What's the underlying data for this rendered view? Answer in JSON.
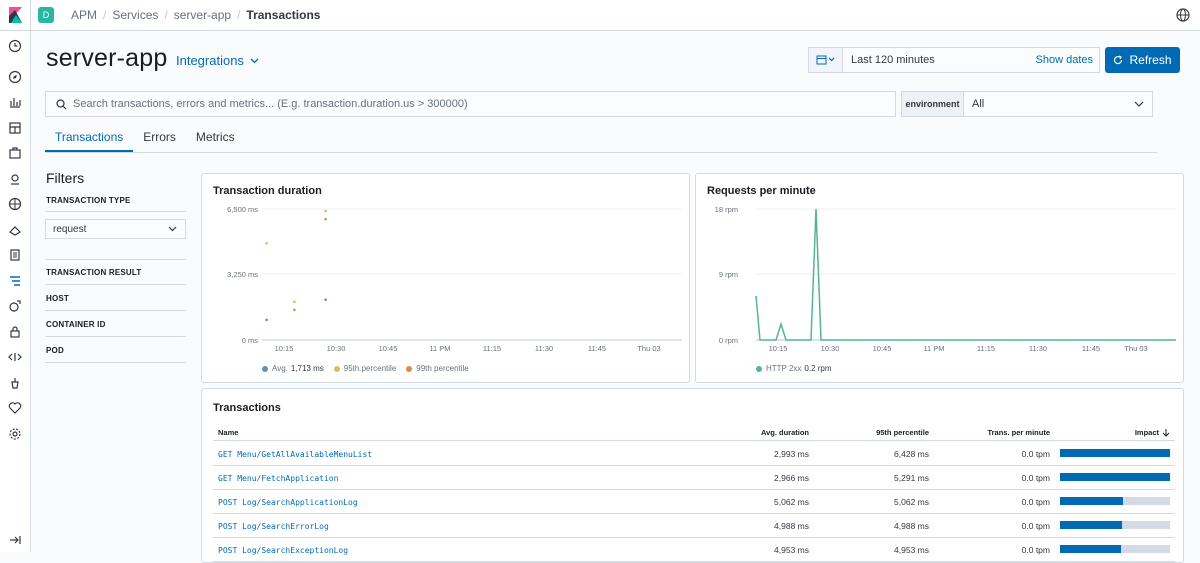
{
  "topbar": {
    "space_letter": "D",
    "breadcrumbs": [
      "APM",
      "Services",
      "server-app",
      "Transactions"
    ]
  },
  "header": {
    "title": "server-app",
    "integrations_label": "Integrations",
    "date_range": "Last 120 minutes",
    "show_dates": "Show dates",
    "refresh_label": "Refresh"
  },
  "search": {
    "placeholder": "Search transactions, errors and metrics... (E.g. transaction.duration.us > 300000)"
  },
  "environment": {
    "label": "environment",
    "value": "All"
  },
  "tabs": [
    "Transactions",
    "Errors",
    "Metrics"
  ],
  "filters": {
    "title": "Filters",
    "transaction_type_label": "TRANSACTION TYPE",
    "transaction_type_value": "request",
    "sections": [
      "TRANSACTION RESULT",
      "HOST",
      "CONTAINER ID",
      "POD"
    ]
  },
  "chart_data": [
    {
      "type": "scatter",
      "title": "Transaction duration",
      "x_ticks": [
        "10:15",
        "10:30",
        "10:45",
        "11 PM",
        "11:15",
        "11:30",
        "11:45",
        "Thu 03"
      ],
      "y_ticks": [
        "6,500 ms",
        "3,250 ms",
        "0 ms"
      ],
      "ylim": [
        0,
        6500
      ],
      "series": [
        {
          "name": "Avg.",
          "value": "1,713 ms",
          "color": "#6092c0"
        },
        {
          "name": "95th percentile",
          "color": "#d6bf57"
        },
        {
          "name": "99th percentile",
          "color": "#da8b45"
        }
      ],
      "points": [
        {
          "x": "10:10",
          "y": 4800,
          "series": 1
        },
        {
          "x": "10:10",
          "y": 1000,
          "series": 0
        },
        {
          "x": "10:18",
          "y": 1900,
          "series": 1
        },
        {
          "x": "10:18",
          "y": 1500,
          "series": 2
        },
        {
          "x": "10:27",
          "y": 6400,
          "series": 1
        },
        {
          "x": "10:27",
          "y": 6000,
          "series": 2
        },
        {
          "x": "10:27",
          "y": 2000,
          "series": 0
        }
      ]
    },
    {
      "type": "line",
      "title": "Requests per minute",
      "x_ticks": [
        "10:15",
        "10:30",
        "10:45",
        "11 PM",
        "11:15",
        "11:30",
        "11:45",
        "Thu 03"
      ],
      "y_ticks": [
        "18 rpm",
        "9 rpm",
        "0 rpm"
      ],
      "ylim": [
        0,
        18
      ],
      "series": [
        {
          "name": "HTTP 2xx",
          "value": "0.2 rpm",
          "color": "#54b399"
        }
      ]
    }
  ],
  "transactions": {
    "title": "Transactions",
    "columns": [
      "Name",
      "Avg. duration",
      "95th percentile",
      "Trans. per minute",
      "Impact"
    ],
    "rows": [
      {
        "name": "GET Menu/GetAllAvailableMenuList",
        "avg": "2,993 ms",
        "p95": "6,428 ms",
        "tpm": "0.0 tpm",
        "impact": 1.0
      },
      {
        "name": "GET Menu/FetchApplication",
        "avg": "2,966 ms",
        "p95": "5,291 ms",
        "tpm": "0.0 tpm",
        "impact": 1.0
      },
      {
        "name": "POST Log/SearchApplicationLog",
        "avg": "5,062 ms",
        "p95": "5,062 ms",
        "tpm": "0.0 tpm",
        "impact": 0.57
      },
      {
        "name": "POST Log/SearchErrorLog",
        "avg": "4,988 ms",
        "p95": "4,988 ms",
        "tpm": "0.0 tpm",
        "impact": 0.56
      },
      {
        "name": "POST Log/SearchExceptionLog",
        "avg": "4,953 ms",
        "p95": "4,953 ms",
        "tpm": "0.0 tpm",
        "impact": 0.55
      }
    ]
  }
}
